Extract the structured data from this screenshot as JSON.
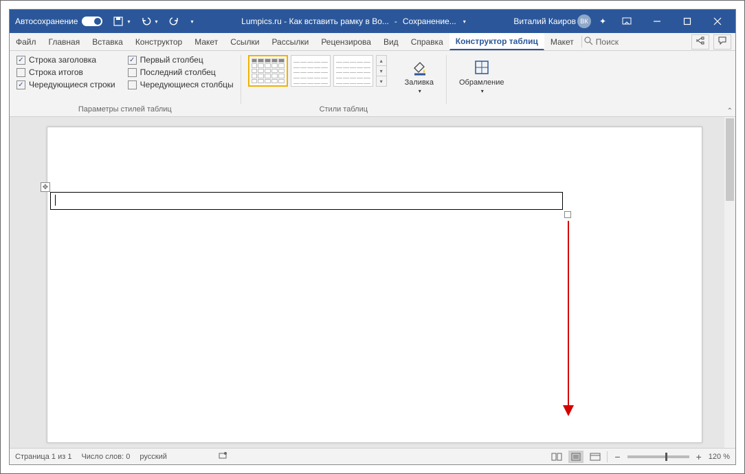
{
  "titlebar": {
    "autosave": "Автосохранение",
    "doc_title": "Lumpics.ru - Как вставить рамку в Во...",
    "save_status": "Сохранение...",
    "user_name": "Виталий Каиров",
    "user_initials": "ВК"
  },
  "tabs": {
    "file": "Файл",
    "home": "Главная",
    "insert": "Вставка",
    "design": "Конструктор",
    "layout": "Макет",
    "references": "Ссылки",
    "mailings": "Рассылки",
    "review": "Рецензирова",
    "view": "Вид",
    "help": "Справка",
    "table_design": "Конструктор таблиц",
    "table_layout": "Макет",
    "search": "Поиск"
  },
  "ribbon": {
    "options_group": "Параметры стилей таблиц",
    "styles_group": "Стили таблиц",
    "header_row": "Строка заголовка",
    "total_row": "Строка итогов",
    "banded_rows": "Чередующиеся строки",
    "first_col": "Первый столбец",
    "last_col": "Последний столбец",
    "banded_cols": "Чередующиеся столбцы",
    "shading": "Заливка",
    "borders": "Обрамление"
  },
  "statusbar": {
    "page": "Страница 1 из 1",
    "words": "Число слов: 0",
    "lang": "русский",
    "zoom": "120 %"
  }
}
